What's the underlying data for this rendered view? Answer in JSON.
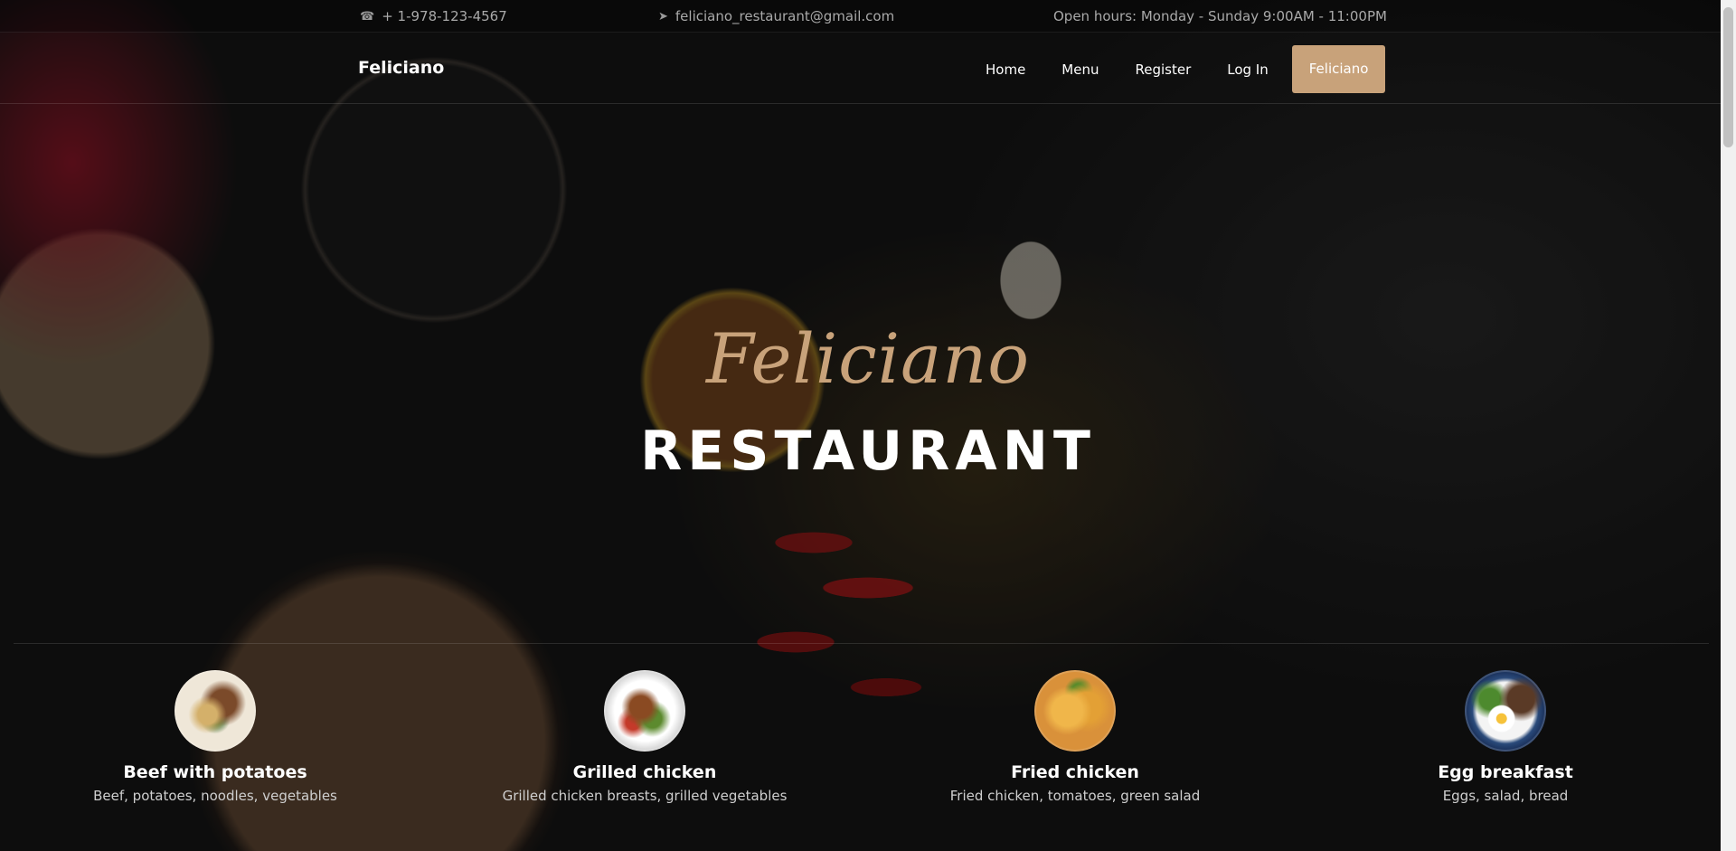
{
  "contact_bar": {
    "phone_icon": "phone-icon",
    "phone": "+ 1-978-123-4567",
    "email_icon": "paper-plane-icon",
    "email": "feliciano_restaurant@gmail.com",
    "hours": "Open hours: Monday - Sunday 9:00AM - 11:00PM"
  },
  "navbar": {
    "brand": "Feliciano",
    "links": [
      "Home",
      "Menu",
      "Register",
      "Log In"
    ],
    "cta": "Feliciano"
  },
  "hero": {
    "script_title": "Feliciano",
    "title": "RESTAURANT"
  },
  "dishes": [
    {
      "name": "Beef with potatoes",
      "description": "Beef, potatoes, noodles, vegetables"
    },
    {
      "name": "Grilled chicken",
      "description": "Grilled chicken breasts, grilled vegetables"
    },
    {
      "name": "Fried chicken",
      "description": "Fried chicken, tomatoes, green salad"
    },
    {
      "name": "Egg breakfast",
      "description": "Eggs, salad, bread"
    }
  ],
  "colors": {
    "accent": "#c8a27a",
    "text": "#ffffff",
    "muted": "#a9a9a9"
  }
}
